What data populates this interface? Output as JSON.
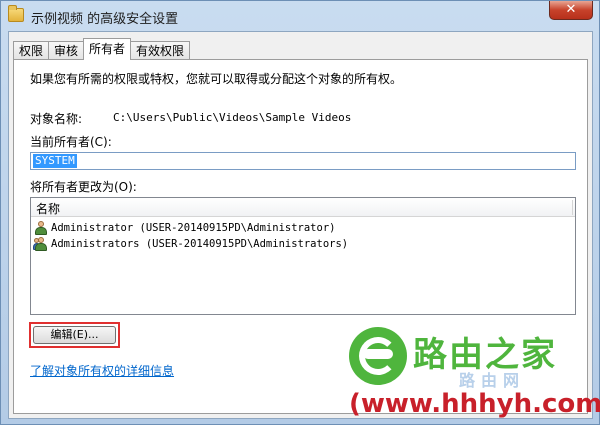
{
  "window": {
    "title": "示例视频 的高级安全设置",
    "close_glyph": "✕"
  },
  "tabs": [
    {
      "label": "权限",
      "active": false
    },
    {
      "label": "审核",
      "active": false
    },
    {
      "label": "所有者",
      "active": true
    },
    {
      "label": "有效权限",
      "active": false
    }
  ],
  "owner_panel": {
    "intro": "如果您有所需的权限或特权，您就可以取得或分配这个对象的所有权。",
    "object_name_label": "对象名称:",
    "object_name_value": "C:\\Users\\Public\\Videos\\Sample Videos",
    "current_owner_label": "当前所有者(C):",
    "current_owner_value": "SYSTEM",
    "change_owner_label": "将所有者更改为(O):",
    "list_header": "名称",
    "owners": [
      {
        "name": "Administrator (USER-20140915PD\\Administrator)",
        "icon": "user-icon"
      },
      {
        "name": "Administrators (USER-20140915PD\\Administrators)",
        "icon": "group-icon"
      }
    ],
    "edit_button": "编辑(E)...",
    "details_link": "了解对象所有权的详细信息"
  },
  "watermark": {
    "brand": "路由之家",
    "url": "(www.hhhyh.com)",
    "faint": "路由网"
  },
  "colors": {
    "accent": "#3399ff",
    "link": "#0066cc",
    "highlight": "#e03030",
    "watermark_green": "#4fb53d",
    "watermark_red": "#c8202a"
  }
}
